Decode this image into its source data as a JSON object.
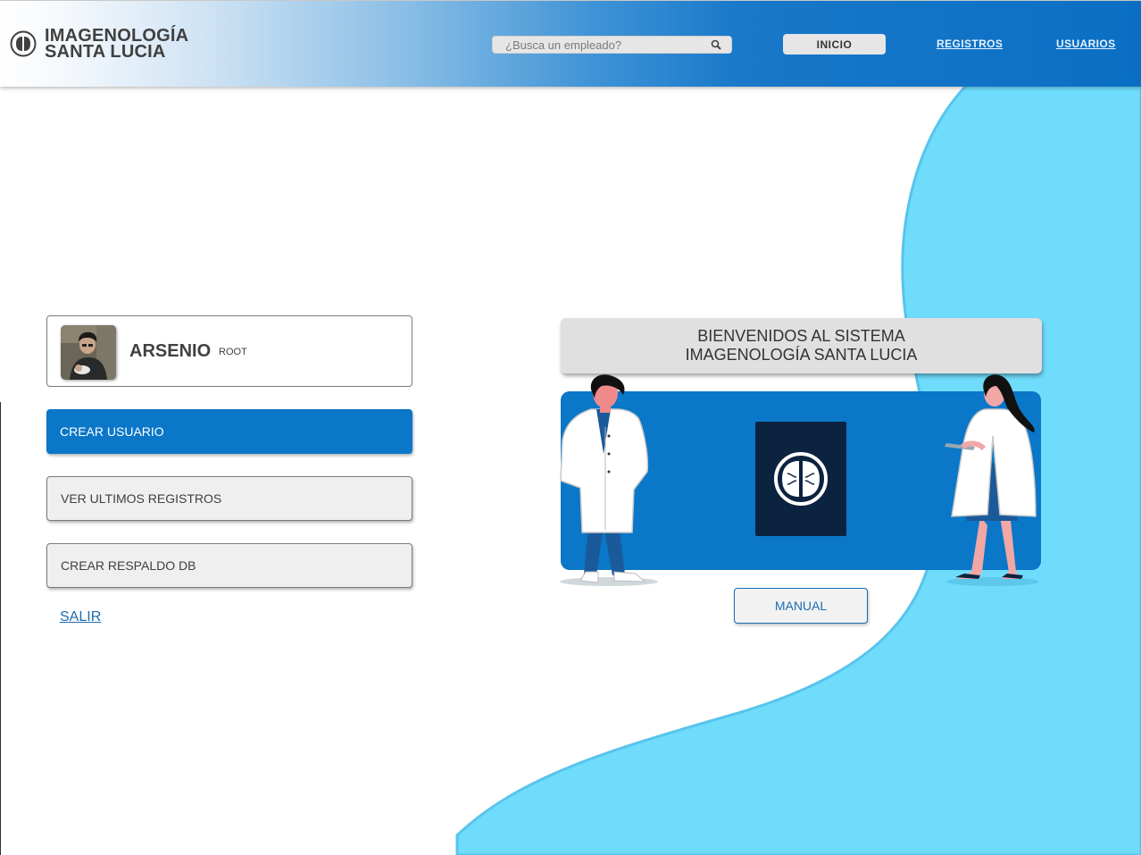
{
  "header": {
    "brand_line1": "IMAGENOLOGÍA",
    "brand_line2": "SANTA LUCIA",
    "search_placeholder": "¿Busca un empleado?",
    "nav": {
      "inicio": "INICIO",
      "registros": "REGISTROS",
      "usuarios": "USUARIOS"
    }
  },
  "profile": {
    "name": "ARSENIO",
    "role": "ROOT"
  },
  "actions": {
    "crear_usuario": "CREAR USUARIO",
    "ver_registros": "VER ULTIMOS REGISTROS",
    "crear_respaldo": "CREAR RESPALDO DB",
    "salir": "SALIR"
  },
  "welcome": {
    "line1": "BIENVENIDOS AL SISTEMA",
    "line2": "IMAGENOLOGÍA SANTA LUCIA"
  },
  "manual_label": "MANUAL",
  "colors": {
    "primary_blue": "#0a77c8",
    "light_blue": "#6fdcfc",
    "dark_navy": "#0c2340"
  },
  "icons": [
    "brain-logo-icon",
    "search-icon",
    "brain-emblem-icon"
  ]
}
